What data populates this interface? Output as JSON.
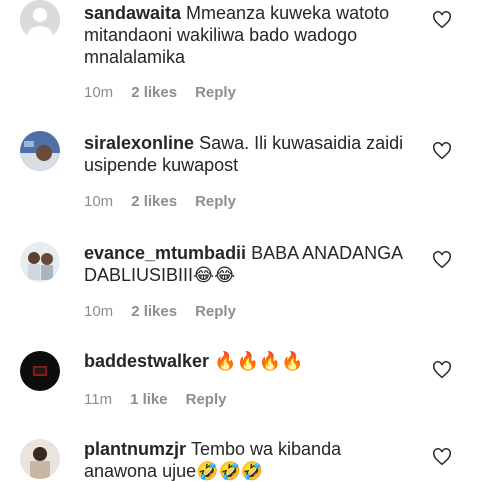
{
  "comments": [
    {
      "username": "sandawaita",
      "text": "Mmeanza kuweka watoto mitandaoni wakiliwa bado wadogo mnalalamika",
      "time": "10m",
      "likes": "2 likes",
      "reply": "Reply"
    },
    {
      "username": "siralexonline",
      "text": "Sawa. Ili kuwasaidia zaidi usipende kuwapost",
      "time": "10m",
      "likes": "2 likes",
      "reply": "Reply"
    },
    {
      "username": "evance_mtumbadii",
      "text": "BABA ANADANGA DABLIUSIBIII😂😂",
      "time": "10m",
      "likes": "2 likes",
      "reply": "Reply"
    },
    {
      "username": "baddestwalker",
      "text": "🔥🔥🔥🔥",
      "time": "11m",
      "likes": "1 like",
      "reply": "Reply"
    },
    {
      "username": "plantnumzjr",
      "text": "Tembo wa kibanda anawona ujue🤣🤣🤣",
      "time": "",
      "likes": "",
      "reply": ""
    }
  ],
  "colors": {
    "text": "#262626",
    "meta": "#8e8e8e"
  }
}
